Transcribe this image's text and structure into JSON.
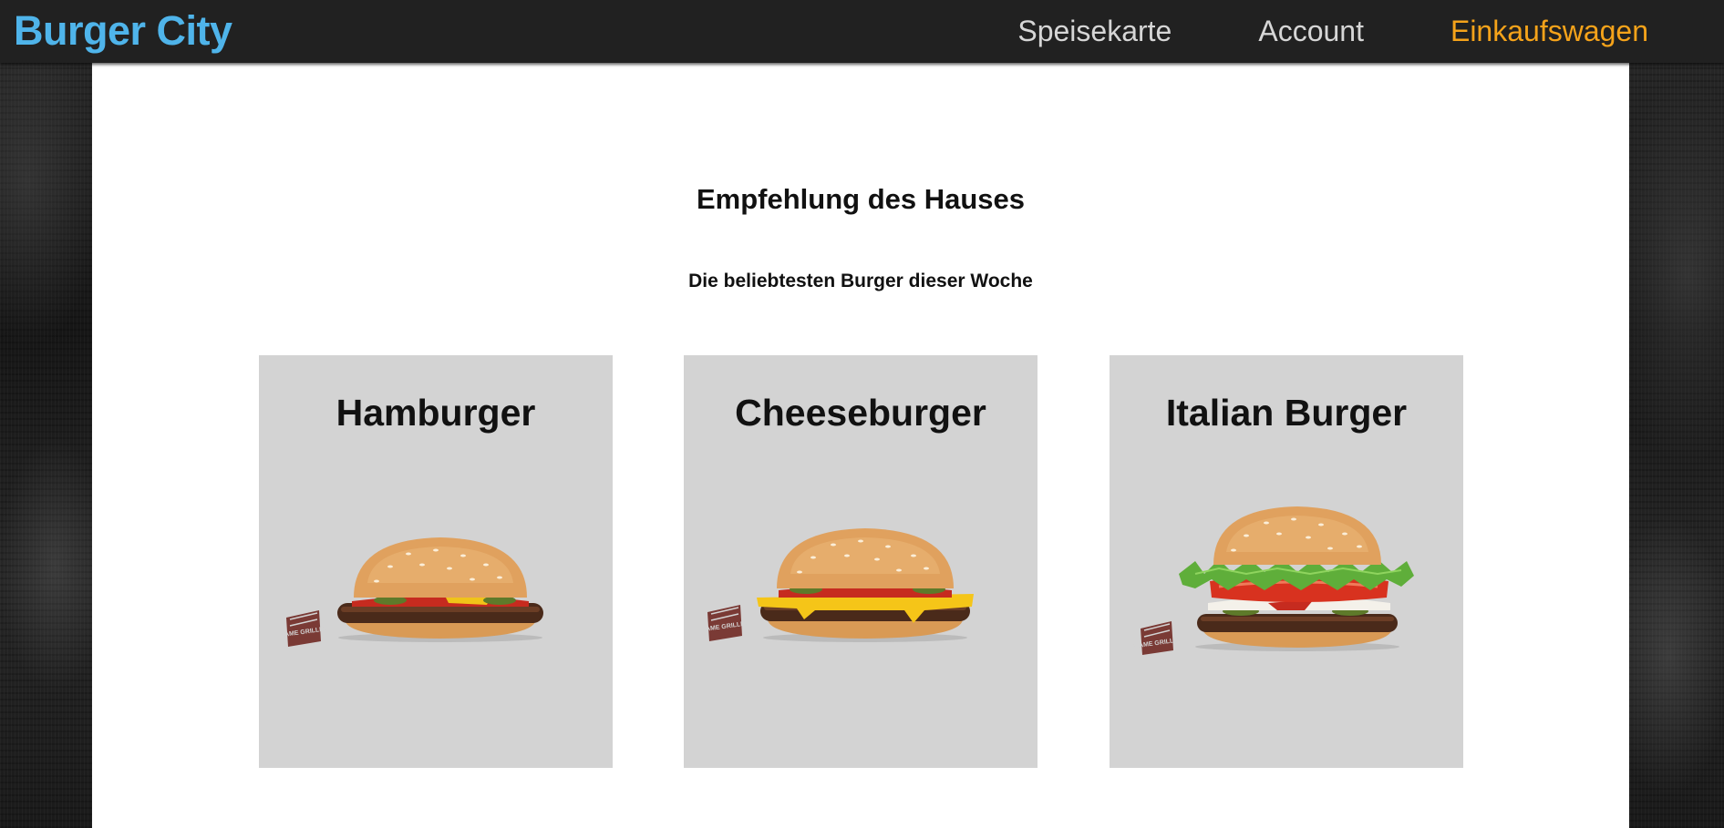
{
  "header": {
    "brand": "Burger City",
    "nav": [
      {
        "label": "Speisekarte",
        "active": false
      },
      {
        "label": "Account",
        "active": false
      },
      {
        "label": "Einkaufswagen",
        "active": true
      }
    ]
  },
  "main": {
    "heading": "Empfehlung des Hauses",
    "subheading": "Die beliebtesten Burger dieser Woche",
    "cards": [
      {
        "title": "Hamburger",
        "image": "hamburger-image"
      },
      {
        "title": "Cheeseburger",
        "image": "cheeseburger-image"
      },
      {
        "title": "Italian Burger",
        "image": "italian-burger-image"
      }
    ],
    "badge_text": "FLAME GRILLED"
  },
  "colors": {
    "brand": "#4fb4ea",
    "nav_active": "#f5a31a",
    "nav_text": "#d6d6d6",
    "navbar_bg": "#212121",
    "card_bg": "#d3d3d3"
  }
}
